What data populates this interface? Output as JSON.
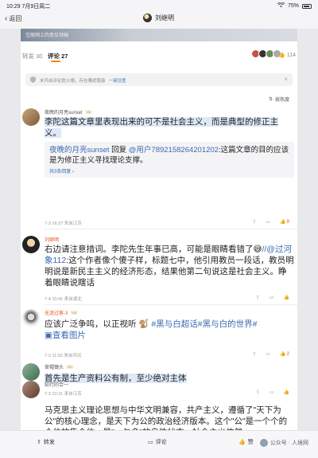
{
  "status": {
    "time": "10:29",
    "date": "7月9日周二",
    "battery": "75%"
  },
  "nav": {
    "back_label": "返回",
    "title": "刘继明"
  },
  "banner": {
    "text": "互联网上的意见领袖"
  },
  "tabs": {
    "repost": "转发 30",
    "comment": "评论 27",
    "likes": "114"
  },
  "notice": {
    "text": "未开启评论防火墙，存在骚扰隐患",
    "action": "一键设置"
  },
  "sort": {
    "label": "按热度"
  },
  "comments": [
    {
      "name": "夜晚的月亮sunset",
      "badge": "vip",
      "text": "李陀这篇文章里表现出来的可不是社会主义，而是典型的修正主义。",
      "reply": {
        "author": "夜晚的月亮sunset",
        "mid": " 回复 ",
        "target": "@用户7892158264201202",
        "text": ":这篇文章的目的应该是为修正主义寻找理论支撑。",
        "more": "共3条回复"
      },
      "meta": "7-3 16:27 来自江苏",
      "likes": "9"
    },
    {
      "name": "刘继明",
      "badge": "",
      "text_a": "右边请注意措词。李陀先生年事已高，可能是眼睛看错了",
      "text_link": "//@过河象112",
      "text_b": ":这个作者像个傻子样，标题七中，他引用教员一段话，教员明明说是新民主主义的经济形态，结果他第二句说这是社会主义。睁着眼睛说瞎话",
      "meta": "7-4 10:41 来自湖北",
      "likes": ""
    },
    {
      "name": "无涯过客-3",
      "badge": "vip",
      "text_a": "应该广泛争鸣，以正视听",
      "text_link": "#黑与白超话#黑与白的世界#",
      "text_c": "查看图片",
      "meta": "7-3 11:50 来自河北",
      "likes": "2"
    },
    {
      "name": "草帽锄头",
      "badge": "vip",
      "text": "首先是生产资料公有制，至少绝对主体",
      "meta": "7-3 10:21 来自江苏",
      "likes": ""
    },
    {
      "name": "知行的合一",
      "badge": "",
      "text": "马克思主义理论思想与中华文明兼容，共产主义，遵循了\"天下为公\"的核心理念，是天下为公的政治经济版本。这个\"公\"是一个个的个体的集合体，是\"一与多\"的良性状态，社会主义依然",
      "meta": "",
      "likes": ""
    }
  ],
  "bottom": {
    "repost": "转发",
    "comment": "评论",
    "like": "赞",
    "watermark": "公众号 · 人境网"
  }
}
